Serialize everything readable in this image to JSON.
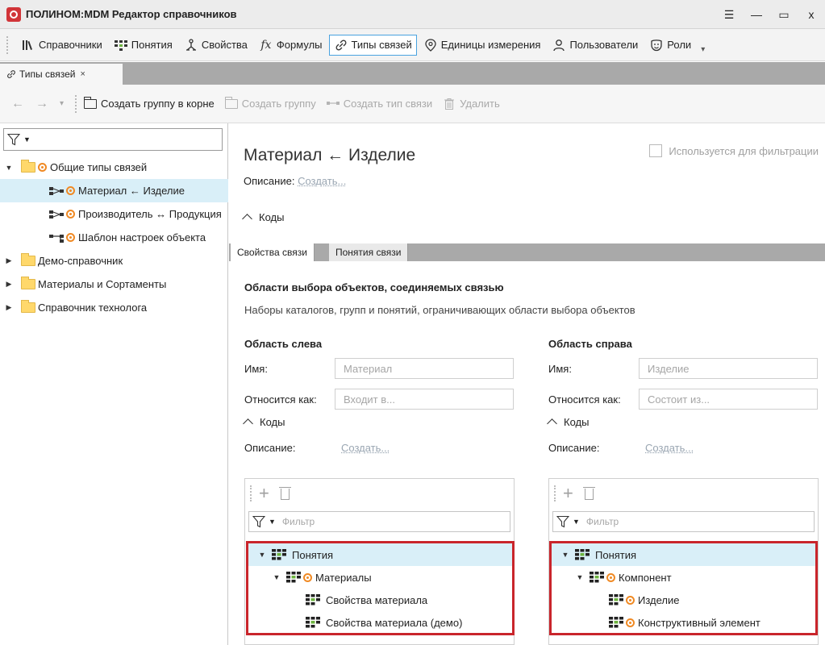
{
  "window": {
    "title": "ПОЛИНОМ:MDM Редактор справочников",
    "controls": [
      "☰",
      "—",
      "▭",
      "x"
    ]
  },
  "toolbar": {
    "items": [
      {
        "label": "Справочники",
        "icon": "books-icon"
      },
      {
        "label": "Понятия",
        "icon": "concepts-icon"
      },
      {
        "label": "Свойства",
        "icon": "properties-icon"
      },
      {
        "label": "Формулы",
        "icon": "formula-icon",
        "prefix": "fx"
      },
      {
        "label": "Типы связей",
        "icon": "link-icon",
        "active": true
      },
      {
        "label": "Единицы измерения",
        "icon": "units-icon"
      },
      {
        "label": "Пользователи",
        "icon": "user-icon"
      },
      {
        "label": "Роли",
        "icon": "mask-icon"
      }
    ]
  },
  "doc_tab": {
    "label": "Типы связей",
    "close": "×"
  },
  "actions": {
    "create_root_group": "Создать группу в корне",
    "create_group": "Создать группу",
    "create_link_type": "Создать тип связи",
    "delete": "Удалить"
  },
  "tree": {
    "items": [
      {
        "label": "Общие типы связей",
        "level": 0,
        "expanded": true,
        "type": "folder",
        "dot": true
      },
      {
        "label": "Материал ← Изделие",
        "level": 1,
        "type": "link",
        "dot": true,
        "selected": true
      },
      {
        "label": "Производитель ↔ Продукция",
        "level": 1,
        "type": "link",
        "dot": true
      },
      {
        "label": "Шаблон настроек объекта",
        "level": 1,
        "type": "link2",
        "dot": true
      },
      {
        "label": "Демо-справочник",
        "level": 0,
        "expanded": false,
        "type": "folder"
      },
      {
        "label": "Материалы и Сортаменты",
        "level": 0,
        "expanded": false,
        "type": "folder"
      },
      {
        "label": "Справочник технолога",
        "level": 0,
        "expanded": false,
        "type": "folder"
      }
    ]
  },
  "detail": {
    "title": "Материал ← Изделие",
    "filter_checkbox_label": "Используется для фильтрации",
    "description_label": "Описание:",
    "create_link": "Создать...",
    "codes_label": "Коды",
    "tabs": [
      "Свойства связи",
      "Понятия связи"
    ],
    "areas_title": "Области выбора объектов, соединяемых связью",
    "areas_subtitle": "Наборы каталогов, групп и понятий, ограничивающих области выбора объектов",
    "left": {
      "heading": "Область слева",
      "name_label": "Имя:",
      "name_value": "Материал",
      "relation_label": "Относится как:",
      "relation_value": "Входит в...",
      "codes_label": "Коды",
      "description_label": "Описание:",
      "create_link": "Создать...",
      "filter_placeholder": "Фильтр",
      "items": [
        {
          "label": "Понятия",
          "level": 0,
          "expanded": true,
          "selected": true
        },
        {
          "label": "Материалы",
          "level": 1,
          "expanded": true,
          "dot": true
        },
        {
          "label": "Свойства материала",
          "level": 2
        },
        {
          "label": "Свойства материала (демо)",
          "level": 2
        }
      ]
    },
    "right": {
      "heading": "Область справа",
      "name_label": "Имя:",
      "name_value": "Изделие",
      "relation_label": "Относится как:",
      "relation_value": "Состоит из...",
      "codes_label": "Коды",
      "description_label": "Описание:",
      "create_link": "Создать...",
      "filter_placeholder": "Фильтр",
      "items": [
        {
          "label": "Понятия",
          "level": 0,
          "expanded": true,
          "selected": true
        },
        {
          "label": "Компонент",
          "level": 1,
          "expanded": true,
          "dot": true
        },
        {
          "label": "Изделие",
          "level": 2,
          "dot": true
        },
        {
          "label": "Конструктивный элемент",
          "level": 2,
          "dot": true
        }
      ]
    }
  },
  "colors": {
    "highlight_border": "#c9252b",
    "selection": "#d9eff8",
    "folder": "#ffd86b",
    "orange_badge": "#f08a24",
    "tab_strip": "#a9a9a9"
  }
}
